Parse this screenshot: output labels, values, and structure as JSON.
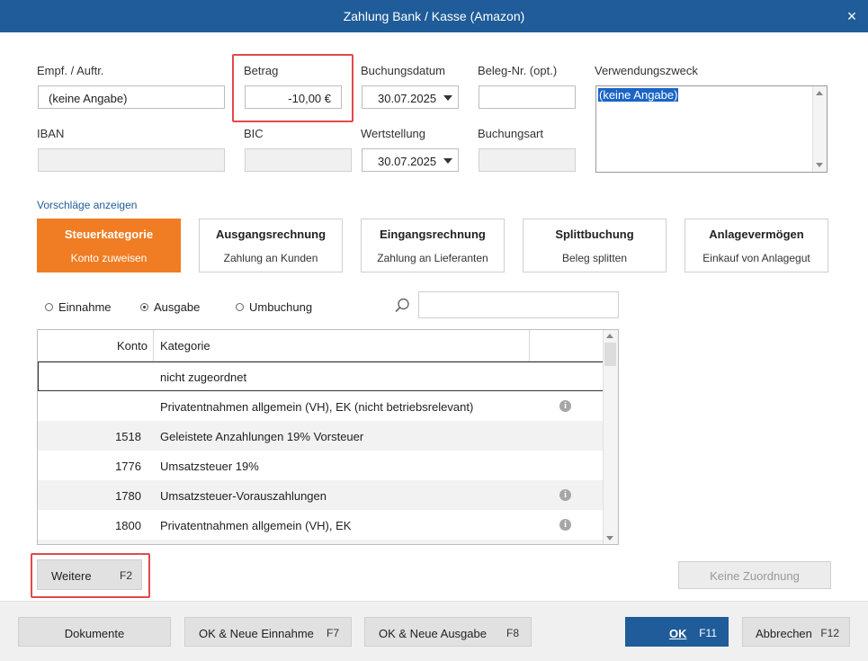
{
  "window": {
    "title": "Zahlung Bank / Kasse (Amazon)",
    "close_label": "×"
  },
  "form": {
    "empf_label": "Empf. / Auftr.",
    "empf_value": "(keine Angabe)",
    "betrag_label": "Betrag",
    "betrag_value": "-10,00 €",
    "buchungsdatum_label": "Buchungsdatum",
    "buchungsdatum_value": "30.07.2025",
    "beleg_label": "Beleg-Nr. (opt.)",
    "beleg_value": "",
    "verwendungszweck_label": "Verwendungszweck",
    "verwendungszweck_value": "(keine Angabe)",
    "iban_label": "IBAN",
    "bic_label": "BIC",
    "wertstellung_label": "Wertstellung",
    "wertstellung_value": "30.07.2025",
    "buchungsart_label": "Buchungsart"
  },
  "suggestions_link": "Vorschläge anzeigen",
  "categories": [
    {
      "title": "Steuerkategorie",
      "subtitle": "Konto zuweisen",
      "active": true
    },
    {
      "title": "Ausgangsrechnung",
      "subtitle": "Zahlung an Kunden"
    },
    {
      "title": "Eingangsrechnung",
      "subtitle": "Zahlung an Lieferanten"
    },
    {
      "title": "Splittbuchung",
      "subtitle": "Beleg splitten"
    },
    {
      "title": "Anlagevermögen",
      "subtitle": "Einkauf von Anlagegut"
    }
  ],
  "type_filter": {
    "options": [
      "Einnahme",
      "Ausgabe",
      "Umbuchung"
    ],
    "selected": "Ausgabe"
  },
  "search": {
    "value": ""
  },
  "table": {
    "headers": {
      "konto": "Konto",
      "kategorie": "Kategorie"
    },
    "rows": [
      {
        "konto": "",
        "kategorie": "nicht zugeordnet",
        "info": false,
        "selected": true
      },
      {
        "konto": "",
        "kategorie": "Privatentnahmen allgemein (VH), EK  (nicht betriebsrelevant)",
        "info": true
      },
      {
        "konto": "1518",
        "kategorie": "Geleistete Anzahlungen 19% Vorsteuer",
        "info": false
      },
      {
        "konto": "1776",
        "kategorie": "Umsatzsteuer 19%",
        "info": false
      },
      {
        "konto": "1780",
        "kategorie": "Umsatzsteuer-Vorauszahlungen",
        "info": true
      },
      {
        "konto": "1800",
        "kategorie": "Privatentnahmen allgemein (VH), EK",
        "info": true
      }
    ]
  },
  "buttons": {
    "weitere": {
      "label": "Weitere",
      "key": "F2"
    },
    "keine_zuordnung": {
      "label": "Keine Zuordnung"
    },
    "dokumente": {
      "label": "Dokumente"
    },
    "ok_neue_einnahme": {
      "label": "OK & Neue Einnahme",
      "key": "F7"
    },
    "ok_neue_ausgabe": {
      "label": "OK & Neue Ausgabe",
      "key": "F8"
    },
    "ok": {
      "label": "OK",
      "key": "F11"
    },
    "abbrechen": {
      "label": "Abbrechen",
      "key": "F12"
    }
  },
  "colors": {
    "titlebar": "#1f5c99",
    "active_category": "#f07d23",
    "highlight": "#e04a4a"
  }
}
